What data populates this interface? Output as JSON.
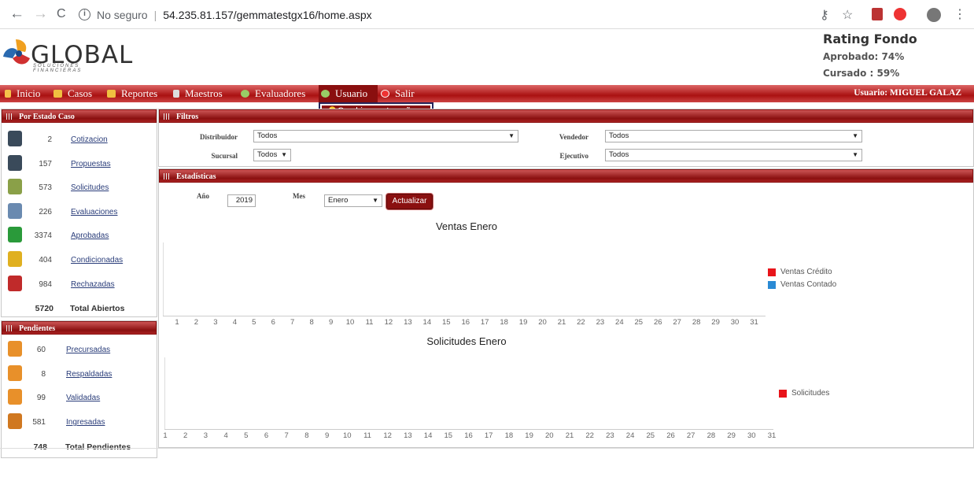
{
  "browser": {
    "back": "←",
    "forward": "→",
    "reload": "C",
    "security": "No seguro",
    "info_glyph": "i",
    "separator": "|",
    "url": "54.235.81.157/gemmatestgx16/home.aspx"
  },
  "logo": {
    "name": "GLOBAL",
    "tagline": "SOLUCIONES FINANCIERAS"
  },
  "rating": {
    "title": "Rating Fondo",
    "aprobado": "Aprobado: 74%",
    "cursado": "Cursado : 59%"
  },
  "menu": {
    "items": [
      "Inicio",
      "Casos",
      "Reportes",
      "Maestros",
      "Evaluadores",
      "Usuario",
      "Salir"
    ],
    "user": "Usuario:  MIGUEL GALAZ",
    "dropdown_item": "Cambiar contraseña"
  },
  "por_estado": {
    "title": "Por Estado Caso",
    "rows": [
      {
        "count": "2",
        "label": "Cotizacion",
        "icon": "calculator-icon",
        "color": "#3a4a5a"
      },
      {
        "count": "157",
        "label": "Propuestas",
        "icon": "calculator-icon",
        "color": "#3a4a5a"
      },
      {
        "count": "573",
        "label": "Solicitudes",
        "icon": "document-edit-icon",
        "color": "#8aa048"
      },
      {
        "count": "226",
        "label": "Evaluaciones",
        "icon": "search-document-icon",
        "color": "#6a8ab0"
      },
      {
        "count": "3374",
        "label": "Aprobadas",
        "icon": "shield-check-icon",
        "color": "#2a9a3a"
      },
      {
        "count": "404",
        "label": "Condicionadas",
        "icon": "shield-warning-icon",
        "color": "#e0b020"
      },
      {
        "count": "984",
        "label": "Rechazadas",
        "icon": "shield-x-icon",
        "color": "#c02a2a"
      }
    ],
    "total_count": "5720",
    "total_label": "Total Abiertos"
  },
  "pendientes": {
    "title": "Pendientes",
    "rows": [
      {
        "count": "60",
        "label": "Precursadas",
        "icon": "folder-icon",
        "color": "#e8902a"
      },
      {
        "count": "8",
        "label": "Respaldadas",
        "icon": "folder-icon",
        "color": "#e8902a"
      },
      {
        "count": "99",
        "label": "Validadas",
        "icon": "folder-icon",
        "color": "#e8902a"
      },
      {
        "count": "581",
        "label": "Ingresadas",
        "icon": "folder-stack-icon",
        "color": "#d07820"
      }
    ],
    "total_count": "748",
    "total_label": "Total Pendientes"
  },
  "filtros": {
    "title": "Filtros",
    "distribuidor_label": "Distribuidor",
    "distribuidor": "Todos",
    "sucursal_label": "Sucursal",
    "sucursal": "Todos",
    "vendedor_label": "Vendedor",
    "vendedor": "Todos",
    "ejecutivo_label": "Ejecutivo",
    "ejecutivo": "Todos",
    "arrow": "▼"
  },
  "estadisticas": {
    "title": "Estadísticas",
    "anio_label": "Año",
    "anio": "2019",
    "mes_label": "Mes",
    "mes": "Enero",
    "button": "Actualizar"
  },
  "chart_data": [
    {
      "type": "bar",
      "title": "Ventas Enero",
      "categories": [
        "1",
        "2",
        "3",
        "4",
        "5",
        "6",
        "7",
        "8",
        "9",
        "10",
        "11",
        "12",
        "13",
        "14",
        "15",
        "16",
        "17",
        "18",
        "19",
        "20",
        "21",
        "22",
        "23",
        "24",
        "25",
        "26",
        "27",
        "28",
        "29",
        "30",
        "31"
      ],
      "series": [
        {
          "name": "Ventas Crédito",
          "color": "#e8141a",
          "values": []
        },
        {
          "name": "Ventas Contado",
          "color": "#2a8ad4",
          "values": []
        }
      ],
      "legend": "right"
    },
    {
      "type": "bar",
      "title": "Solicitudes Enero",
      "categories": [
        "1",
        "2",
        "3",
        "4",
        "5",
        "6",
        "7",
        "8",
        "9",
        "10",
        "11",
        "12",
        "13",
        "14",
        "15",
        "16",
        "17",
        "18",
        "19",
        "20",
        "21",
        "22",
        "23",
        "24",
        "25",
        "26",
        "27",
        "28",
        "29",
        "30",
        "31"
      ],
      "series": [
        {
          "name": "Solicitudes",
          "color": "#e8141a",
          "values": []
        }
      ],
      "legend": "right"
    }
  ]
}
